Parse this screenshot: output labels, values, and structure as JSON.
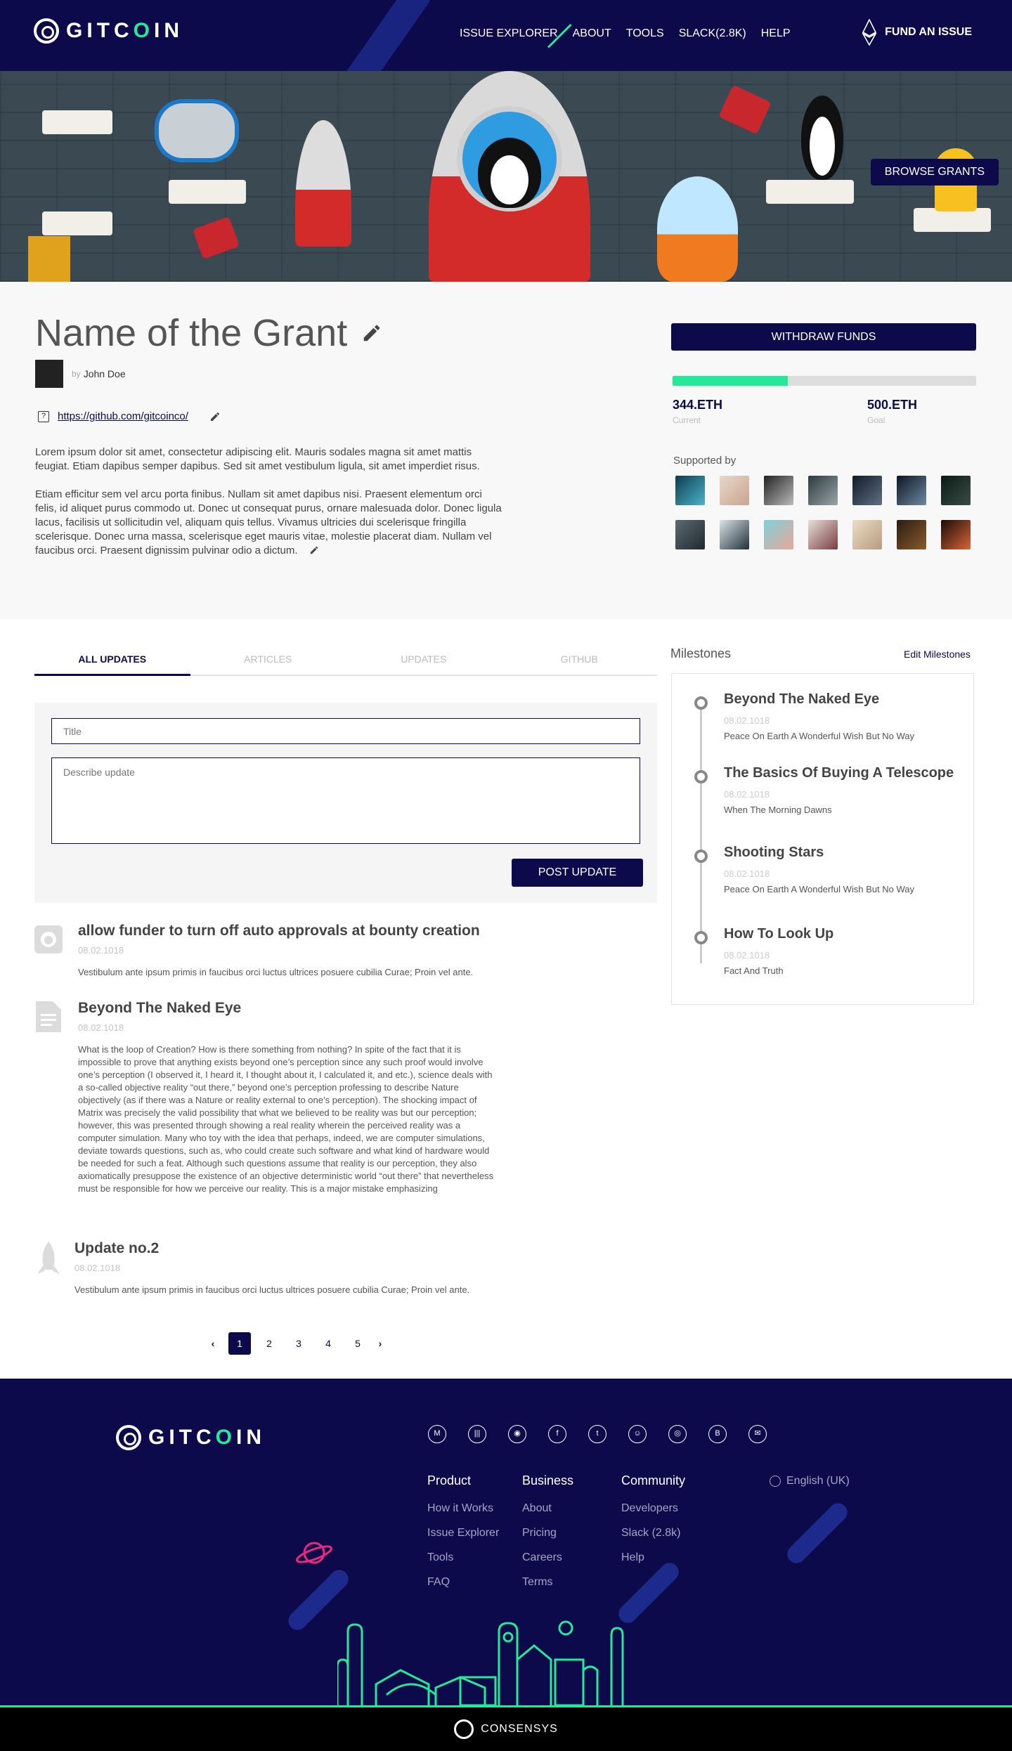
{
  "header": {
    "logo_text_pre": "GITC",
    "logo_text_o": "O",
    "logo_text_post": "IN",
    "nav": [
      "ISSUE EXPLORER",
      "ABOUT",
      "TOOLS",
      "SLACK(2.8K)",
      "HELP"
    ],
    "fund_label": "FUND AN ISSUE"
  },
  "hero": {
    "browse_label": "BROWSE GRANTS"
  },
  "grant": {
    "title": "Name of the Grant",
    "by": "by",
    "author": "John Doe",
    "repo_link": "https://github.com/gitcoinco/",
    "description": [
      "Lorem ipsum dolor sit amet, consectetur adipiscing elit. Mauris sodales magna sit amet mattis feugiat. Etiam dapibus semper dapibus. Sed sit amet vestibulum ligula, sit amet imperdiet risus.",
      " Etiam efficitur sem vel arcu porta finibus. Nullam sit amet dapibus nisi. Praesent elementum orci felis, id aliquet purus commodo ut. Donec ut consequat purus, ornare malesuada dolor. Donec ligula lacus, facilisis ut sollicitudin vel, aliquam quis tellus. Vivamus ultricies dui scelerisque fringilla scelerisque. Donec urna massa, scelerisque eget mauris vitae, molestie placerat diam. Nullam vel faucibus orci. Praesent dignissim pulvinar odio a dictum."
    ],
    "withdraw_label": "WITHDRAW FUNDS",
    "progress_fraction": 0.38,
    "current_value": "344.ETH",
    "current_label": "Current",
    "goal_value": "500.ETH",
    "goal_label": "Goal",
    "supported_by": "Supported by",
    "colors": {
      "brand": "#0d0a4b",
      "accent": "#25e899"
    }
  },
  "feed": {
    "tabs": [
      "ALL UPDATES",
      "ARTICLES",
      "UPDATES",
      "GITHUB"
    ],
    "title_placeholder": "Title",
    "describe_placeholder": "Describe update",
    "post_label": "POST UPDATE",
    "updates": [
      {
        "icon": "github-icon",
        "title": "allow funder to turn off auto approvals at bounty creation",
        "date": "08.02.1018",
        "body": "Vestibulum ante ipsum primis in faucibus orci luctus  ultrices posuere cubilia Curae; Proin vel ante."
      },
      {
        "icon": "document-icon",
        "title": "Beyond The Naked Eye",
        "date": "08.02.1018",
        "body": "What is the loop of Creation? How is there something from nothing? In spite of the fact that it is impossible to prove that anything exists beyond one’s perception since any such proof would involve one’s perception (I observed it, I heard it, I thought about it, I calculated it, and etc.), science deals with a so-called objective reality “out there,” beyond one’s perception professing to describe Nature objectively (as if there was a Nature or reality external to one’s perception). The shocking impact of Matrix was precisely the valid possibility that what we believed to be reality was but our perception; however, this was presented through showing a real reality wherein the perceived reality was a computer simulation. Many who toy with the idea that perhaps, indeed, we are computer simulations, deviate towards questions, such as, who could create such software and what kind of hardware would be needed for such a feat. Although such questions assume that reality is our perception, they also axiomatically presuppose the existence of an objective deterministic world “out there” that nevertheless must be responsible for how we perceive our reality. This is a major mistake emphasizing"
      },
      {
        "icon": "rocket-icon",
        "title": "Update no.2",
        "date": "08.02.1018",
        "body": "Vestibulum ante ipsum primis in faucibus orci luctus  ultrices posuere cubilia Curae; Proin vel ante."
      }
    ],
    "pagination": [
      "1",
      "2",
      "3",
      "4",
      "5"
    ],
    "current_page": "1"
  },
  "milestones": {
    "heading": "Milestones",
    "edit_label": "Edit Milestones",
    "items": [
      {
        "title": "Beyond The Naked Eye",
        "date": "08.02.1018",
        "subtitle": "Peace On Earth A Wonderful Wish But No Way"
      },
      {
        "title": "The Basics Of Buying A Telescope",
        "date": "08.02.1018",
        "subtitle": "When The Morning Dawns"
      },
      {
        "title": "Shooting Stars",
        "date": "08.02.1018",
        "subtitle": "Peace On Earth A Wonderful Wish But No Way"
      },
      {
        "title": "How To Look Up",
        "date": "08.02.1018",
        "subtitle": "Fact And Truth"
      }
    ]
  },
  "footer": {
    "socials": [
      "medium-icon",
      "gitter-icon",
      "github-icon",
      "facebook-icon",
      "twitter-icon",
      "reddit-icon",
      "discord-icon",
      "bitcoin-icon",
      "email-icon"
    ],
    "columns": [
      {
        "heading": "Product",
        "links": [
          "How it Works",
          "Issue Explorer",
          "Tools",
          "FAQ"
        ]
      },
      {
        "heading": "Business",
        "links": [
          "About",
          "Pricing",
          "Careers",
          "Terms"
        ]
      },
      {
        "heading": "Community",
        "links": [
          "Developers",
          "Slack (2.8k)",
          "Help"
        ]
      }
    ],
    "language": "English (UK)",
    "consensys_label": "CONSENSYS"
  }
}
